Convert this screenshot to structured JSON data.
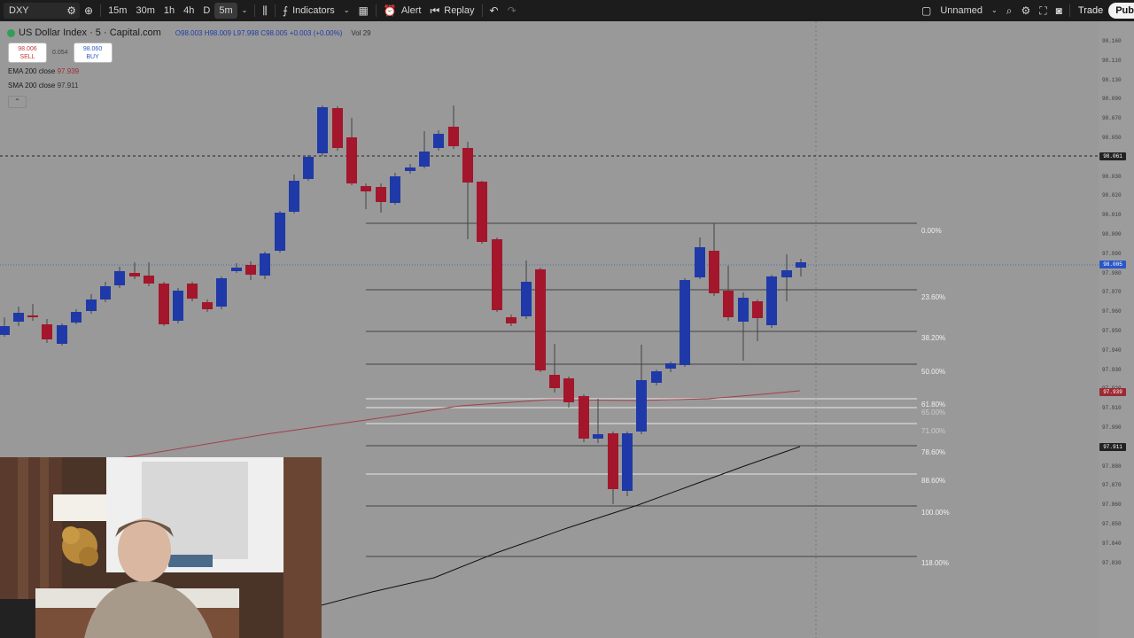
{
  "toolbar": {
    "symbol": "DXY",
    "timeframes": [
      "15m",
      "30m",
      "1h",
      "4h",
      "D",
      "5m"
    ],
    "active_timeframe": "5m",
    "indicators_label": "Indicators",
    "alert_label": "Alert",
    "replay_label": "Replay",
    "layout_name": "Unnamed",
    "trade_label": "Trade",
    "publish_label": "Pub"
  },
  "legend": {
    "title": "US Dollar Index · 5 · Capital.com",
    "ohlc": "O98.003  H98.009  L97.998  C98.005  +0.003 (+0.00%)",
    "vol": "Vol 29",
    "sell_price": "98.006",
    "sell_label": "SELL",
    "spread": "0.054",
    "buy_price": "98.060",
    "buy_label": "BUY",
    "ema_label": "EMA 200 close",
    "ema_value": "97.939",
    "sma_label": "SMA 200 close",
    "sma_value": "97.911"
  },
  "price_axis": {
    "ticks": [
      "98.160",
      "98.110",
      "98.130",
      "98.090",
      "98.070",
      "98.050",
      "98.040",
      "98.030",
      "98.020",
      "98.010",
      "98.000",
      "97.990",
      "97.980",
      "97.970",
      "97.960",
      "97.950",
      "97.940",
      "97.930",
      "97.920",
      "97.910",
      "97.900",
      "97.890",
      "97.880",
      "97.870",
      "97.860",
      "97.850",
      "97.840",
      "97.830"
    ],
    "crosshair_price": "98.061",
    "last_price": "98.005",
    "ema_tag": "97.939",
    "sma_tag": "97.911"
  },
  "fib": {
    "levels": [
      "0.00%",
      "23.60%",
      "38.20%",
      "50.00%",
      "61.80%",
      "65.00%",
      "71.00%",
      "78.60%",
      "88.60%",
      "100.00%",
      "118.00%"
    ]
  },
  "colors": {
    "up_candle": "#1f39a8",
    "down_candle": "#a3162b",
    "background": "#999999",
    "toolbar": "#1c1c1c",
    "ema": "#a2404a",
    "sma": "#111111"
  }
}
